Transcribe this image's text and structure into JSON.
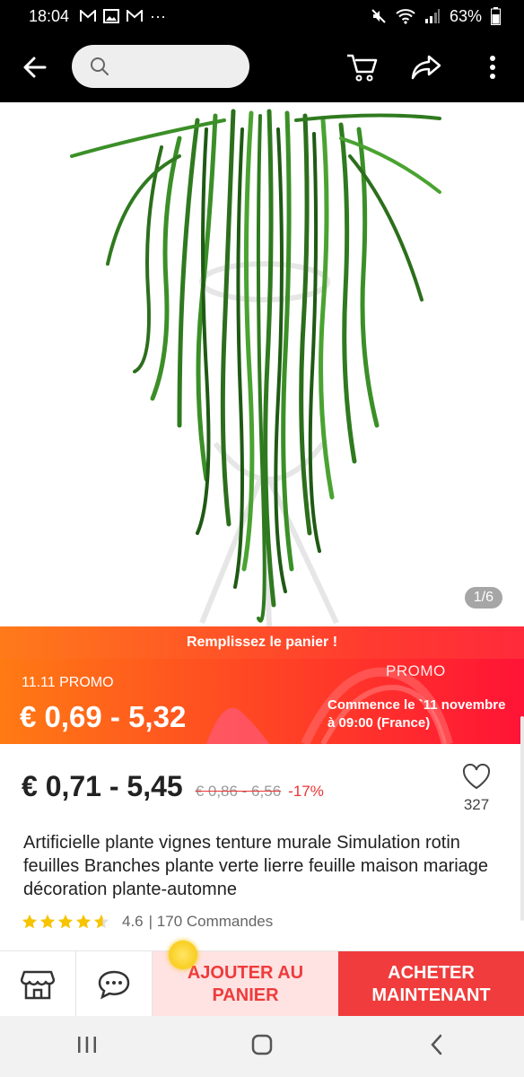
{
  "status": {
    "time": "18:04",
    "notif_icons": [
      "gmail-icon",
      "image-icon",
      "gmail-icon"
    ],
    "more": "···",
    "battery": "63%"
  },
  "topbar": {
    "search_placeholder": ""
  },
  "hero": {
    "counter": "1/6"
  },
  "promo": {
    "banner": "Remplissez le panier !",
    "left_label": "11.11 PROMO",
    "left_price": "€ 0,69 - 5,32",
    "right_label": "PROMO",
    "right_text": "Commence le `11 novembre à 09:00 (France)"
  },
  "product": {
    "price": "€ 0,71 - 5,45",
    "old_price": "€ 0,86 - 6,56",
    "discount": "-17%",
    "wish_count": "327",
    "title": "Artificielle plante vignes tenture murale Simulation rotin feuilles Branches plante verte lierre feuille maison mariage décoration plante-automne",
    "rating": "4.6",
    "orders": "| 170 Commandes"
  },
  "actions": {
    "add_to_cart": "AJOUTER AU PANIER",
    "buy_now": "ACHETER MAINTENANT"
  },
  "colors": {
    "accent": "#f03c3c",
    "promo_orange": "#ff7a14",
    "star": "#f7c400"
  }
}
